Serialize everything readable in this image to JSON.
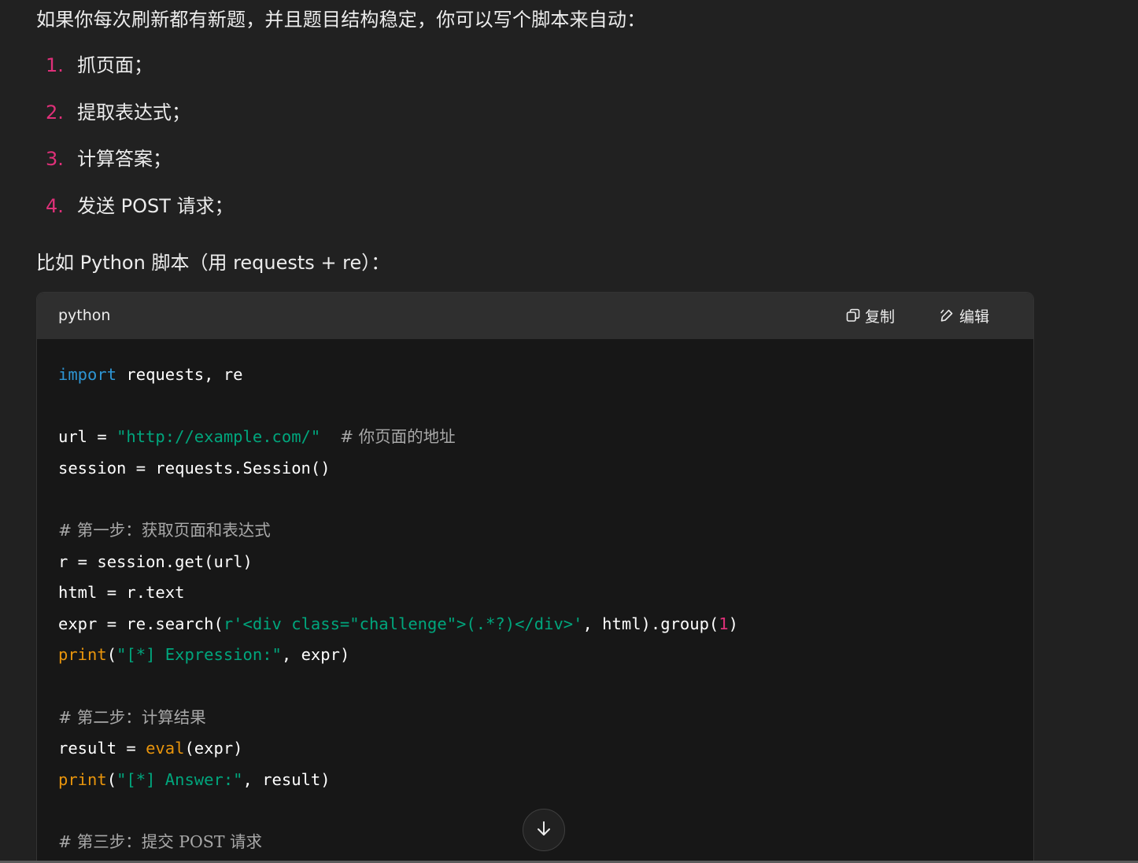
{
  "intro_text": "如果你每次刷新都有新题，并且题目结构稳定，你可以写个脚本来自动：",
  "steps": [
    {
      "num": "1.",
      "text": "抓页面；"
    },
    {
      "num": "2.",
      "text": "提取表达式；"
    },
    {
      "num": "3.",
      "text": "计算答案；"
    },
    {
      "num": "4.",
      "text": "发送 POST 请求；"
    }
  ],
  "lead_text": "比如 Python 脚本（用 requests + re）：",
  "code_block": {
    "language": "python",
    "copy_label": "复制",
    "edit_label": "编辑",
    "lines": [
      [
        {
          "t": "import",
          "c": "kw"
        },
        {
          "t": " requests, re",
          "c": ""
        }
      ],
      [],
      [
        {
          "t": "url = ",
          "c": ""
        },
        {
          "t": "\"http://example.com/\"",
          "c": "str"
        },
        {
          "t": "  ",
          "c": ""
        },
        {
          "t": "# 你页面的地址",
          "c": "cm"
        }
      ],
      [
        {
          "t": "session = requests.Session()",
          "c": ""
        }
      ],
      [],
      [
        {
          "t": "# 第一步：获取页面和表达式",
          "c": "cm"
        }
      ],
      [
        {
          "t": "r = session.get(url)",
          "c": ""
        }
      ],
      [
        {
          "t": "html = r.text",
          "c": ""
        }
      ],
      [
        {
          "t": "expr = re.search(",
          "c": ""
        },
        {
          "t": "r'<div class=\"challenge\">(.*?)</div>'",
          "c": "str"
        },
        {
          "t": ", html).group(",
          "c": ""
        },
        {
          "t": "1",
          "c": "num"
        },
        {
          "t": ")",
          "c": ""
        }
      ],
      [
        {
          "t": "print",
          "c": "fn"
        },
        {
          "t": "(",
          "c": ""
        },
        {
          "t": "\"[*] Expression:\"",
          "c": "str"
        },
        {
          "t": ", expr)",
          "c": ""
        }
      ],
      [],
      [
        {
          "t": "# 第二步：计算结果",
          "c": "cm"
        }
      ],
      [
        {
          "t": "result = ",
          "c": ""
        },
        {
          "t": "eval",
          "c": "fn"
        },
        {
          "t": "(expr)",
          "c": ""
        }
      ],
      [
        {
          "t": "print",
          "c": "fn"
        },
        {
          "t": "(",
          "c": ""
        },
        {
          "t": "\"[*] Answer:\"",
          "c": "str"
        },
        {
          "t": ", result)",
          "c": ""
        }
      ],
      [],
      [
        {
          "t": "# 第三步：提交 POST 请求",
          "c": "cm"
        }
      ]
    ]
  },
  "colors": {
    "background": "#212121",
    "code_background": "#171717",
    "header_background": "#2f2f2f",
    "keyword": "#2e95d3",
    "string": "#00a67d",
    "builtin": "#e9950c",
    "number": "#df3079",
    "comment": "#a8a8a8"
  },
  "icons": {
    "copy": "copy-icon",
    "edit": "edit-icon",
    "scroll": "arrow-down-icon"
  }
}
